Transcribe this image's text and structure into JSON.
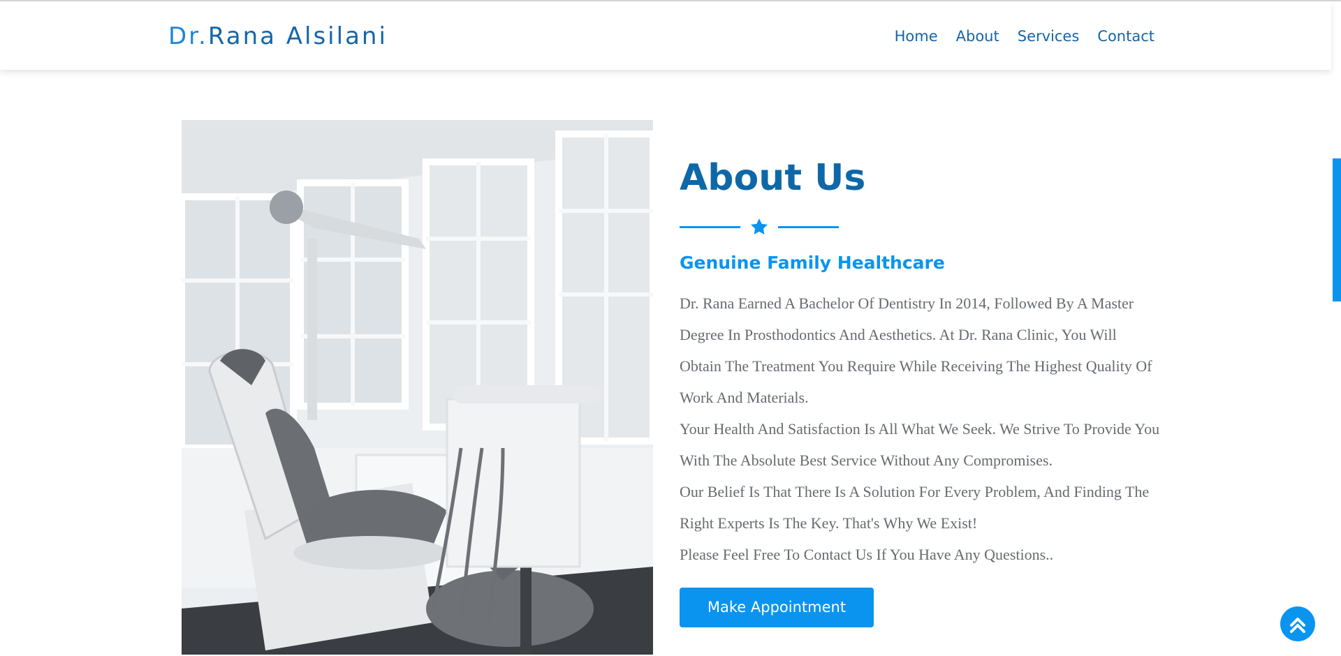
{
  "header": {
    "brand_prefix": "Dr.",
    "brand_name": "Rana Alsilani",
    "nav": [
      "Home",
      "About",
      "Services",
      "Contact"
    ]
  },
  "about": {
    "title": "About Us",
    "divider_icon": "star-icon",
    "subtitle": "Genuine Family Healthcare",
    "paragraphs": [
      "Dr. Rana Earned A Bachelor Of Dentistry In 2014, Followed By A Master Degree In Prosthodontics And Aesthetics. At Dr. Rana Clinic, You Will Obtain The Treatment You Require While Receiving The Highest Quality Of Work And Materials.",
      "Your Health And Satisfaction Is All What We Seek. We Strive To Provide You With The Absolute Best Service Without Any Compromises.",
      "Our Belief Is That There Is A Solution For Every Problem, And Finding The Right Experts Is The Key. That's Why We Exist!",
      "Please Feel Free To Contact Us If You Have Any Questions.."
    ],
    "cta_label": "Make Appointment"
  },
  "image": {
    "subject": "dental-chair-photo"
  },
  "scroll_top": {
    "icon": "double-chevron-up-icon"
  },
  "colors": {
    "primary": "#0a94f0",
    "brand_dark": "#1565a8",
    "body_text": "#666a70"
  }
}
